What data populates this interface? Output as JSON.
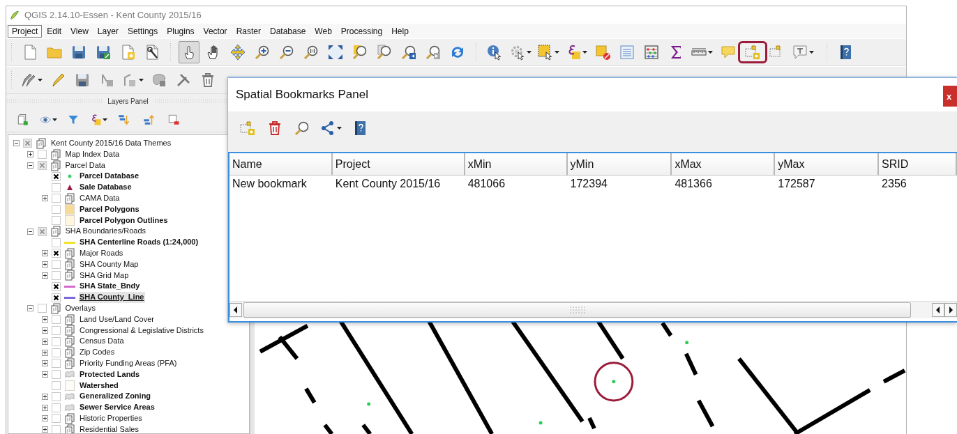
{
  "window": {
    "title": "QGIS 2.14.10-Essen - Kent County 2015/16"
  },
  "menu": [
    {
      "label": "Project",
      "selected": true
    },
    {
      "label": "Edit",
      "selected": false
    },
    {
      "label": "View",
      "selected": false
    },
    {
      "label": "Layer",
      "selected": false
    },
    {
      "label": "Settings",
      "selected": false
    },
    {
      "label": "Plugins",
      "selected": false
    },
    {
      "label": "Vector",
      "selected": false
    },
    {
      "label": "Raster",
      "selected": false
    },
    {
      "label": "Database",
      "selected": false
    },
    {
      "label": "Web",
      "selected": false
    },
    {
      "label": "Processing",
      "selected": false
    },
    {
      "label": "Help",
      "selected": false
    }
  ],
  "toolbars": [
    {
      "groups": [
        {
          "buttons": [
            {
              "kind": "page"
            },
            {
              "kind": "folder"
            },
            {
              "kind": "floppy"
            },
            {
              "kind": "floppy_edit"
            },
            {
              "kind": "page_star"
            },
            {
              "kind": "page_wrench"
            }
          ]
        },
        {
          "buttons": [
            {
              "kind": "touch",
              "selected": true
            },
            {
              "kind": "hand",
              "selected": false
            },
            {
              "kind": "arrows",
              "selected": false
            },
            {
              "kind": "zoom_in",
              "selected": false
            },
            {
              "kind": "zoom_out",
              "selected": false
            },
            {
              "kind": "zoom_native",
              "selected": false
            },
            {
              "kind": "extent",
              "selected": false
            },
            {
              "kind": "zoom_layer",
              "selected": false
            },
            {
              "kind": "zoom_sel",
              "selected": false
            },
            {
              "kind": "zoom_last",
              "selected": false
            },
            {
              "kind": "zoom_next",
              "selected": false
            },
            {
              "kind": "refresh",
              "selected": false
            }
          ]
        },
        {
          "buttons": [
            {
              "kind": "info"
            },
            {
              "kind": "gear",
              "menu": true
            },
            {
              "kind": "select",
              "menu": true
            },
            {
              "kind": "epsilon",
              "menu": true
            },
            {
              "kind": "deselect"
            },
            {
              "kind": "table"
            },
            {
              "kind": "abacus"
            },
            {
              "kind": "sigma"
            },
            {
              "kind": "ruler",
              "menu": true
            },
            {
              "kind": "balloon"
            },
            {
              "kind": "bookmark_new",
              "highlighted": true
            },
            {
              "kind": "bookmarks"
            },
            {
              "kind": "text_balloon",
              "menu": true
            }
          ]
        },
        {
          "buttons": [
            {
              "kind": "help"
            }
          ]
        }
      ]
    },
    {
      "groups": [
        {
          "buttons": [
            {
              "kind": "pencils_gray",
              "menu": true
            },
            {
              "kind": "pencil"
            },
            {
              "kind": "save_gray"
            },
            {
              "kind": "vertex"
            },
            {
              "kind": "node",
              "menu": true
            },
            {
              "kind": "blob"
            },
            {
              "kind": "pen_wrench"
            },
            {
              "kind": "trash_gray"
            }
          ]
        }
      ]
    }
  ],
  "layers_panel": {
    "title": "Layers Panel",
    "tools": [
      {
        "kind": "add_group"
      },
      {
        "kind": "eye",
        "menu": true
      },
      {
        "kind": "filter"
      },
      {
        "kind": "epsilon",
        "menu": true
      },
      {
        "kind": "expand_all"
      },
      {
        "kind": "collapse_all"
      },
      {
        "kind": "remove_layer"
      }
    ],
    "tree": [
      {
        "label": "Kent County 2015/16 Data Themes",
        "kind": "group",
        "checked": false,
        "partial": true,
        "expanded": true,
        "selected": false,
        "children": [
          {
            "label": "Map Index Data",
            "kind": "group",
            "checked": false,
            "partial": false,
            "expanded": false,
            "selected": false
          },
          {
            "label": "Parcel Data",
            "kind": "group",
            "checked": false,
            "partial": true,
            "expanded": true,
            "selected": false,
            "children": [
              {
                "label": "Parcel Database",
                "kind": "point",
                "color": "#3ccf6e",
                "checked": true,
                "partial": false,
                "selected": false
              },
              {
                "label": "Sale Database",
                "kind": "triangle",
                "color": "#a3174a",
                "checked": false,
                "partial": false,
                "selected": false
              },
              {
                "label": "CAMA Data",
                "kind": "group",
                "checked": false,
                "partial": false,
                "expanded": false,
                "selected": false
              },
              {
                "label": "Parcel Polygons",
                "kind": "polygon",
                "color": "#f6dc9a",
                "checked": false,
                "partial": false,
                "selected": false
              },
              {
                "label": "Parcel Polygon Outlines",
                "kind": "polygon",
                "color": "#fff6e0",
                "checked": false,
                "partial": false,
                "selected": false
              }
            ]
          },
          {
            "label": "SHA Boundaries/Roads",
            "kind": "group",
            "checked": false,
            "partial": true,
            "expanded": true,
            "selected": false,
            "children": [
              {
                "label": "SHA Centerline Roads (1:24,000)",
                "kind": "line",
                "color": "#f3e22a",
                "checked": false,
                "partial": false,
                "selected": false
              },
              {
                "label": "Major Roads",
                "kind": "group",
                "checked": true,
                "partial": false,
                "expanded": false,
                "selected": false
              },
              {
                "label": "SHA County Map",
                "kind": "group",
                "checked": false,
                "partial": false,
                "expanded": false,
                "selected": false
              },
              {
                "label": "SHA Grid Map",
                "kind": "group",
                "checked": false,
                "partial": false,
                "expanded": false,
                "selected": false
              },
              {
                "label": "SHA State_Bndy",
                "kind": "line",
                "color": "#d46ad0",
                "checked": true,
                "partial": false,
                "selected": false
              },
              {
                "label": "SHA County_Line",
                "kind": "line",
                "color": "#7a6ad8",
                "checked": true,
                "partial": false,
                "selected": true
              }
            ]
          },
          {
            "label": "Overlays",
            "kind": "group",
            "checked": false,
            "partial": false,
            "expanded": true,
            "selected": false,
            "children": [
              {
                "label": "Land Use/Land Cover",
                "kind": "group",
                "checked": false,
                "partial": false,
                "expanded": false,
                "selected": false
              },
              {
                "label": "Congressional & Legislative Districts",
                "kind": "group",
                "checked": false,
                "partial": false,
                "expanded": false,
                "selected": false
              },
              {
                "label": "Census Data",
                "kind": "group",
                "checked": false,
                "partial": false,
                "expanded": false,
                "selected": false
              },
              {
                "label": "Zip Codes",
                "kind": "group",
                "checked": false,
                "partial": false,
                "expanded": false,
                "selected": false
              },
              {
                "label": "Priority Funding Areas (PFA)",
                "kind": "group",
                "checked": false,
                "partial": false,
                "expanded": false,
                "selected": false
              },
              {
                "label": "Protected Lands",
                "kind": "categorized",
                "checked": false,
                "partial": false,
                "expanded": false,
                "selected": false
              },
              {
                "label": "Watershed",
                "kind": "polygon",
                "color": "#fcfcf8",
                "checked": false,
                "partial": false,
                "selected": false
              },
              {
                "label": "Generalized Zoning",
                "kind": "categorized",
                "checked": false,
                "partial": false,
                "expanded": false,
                "selected": false
              },
              {
                "label": "Sewer Service Areas",
                "kind": "categorized",
                "checked": false,
                "partial": false,
                "expanded": false,
                "selected": false
              },
              {
                "label": "Historic Properties",
                "kind": "group",
                "checked": false,
                "partial": false,
                "expanded": false,
                "selected": false
              },
              {
                "label": "Residential Sales",
                "kind": "group",
                "checked": false,
                "partial": false,
                "expanded": false,
                "selected": false
              }
            ]
          }
        ]
      }
    ]
  },
  "bookmarks": {
    "title": "Spatial Bookmarks Panel",
    "close": "x",
    "tools": [
      {
        "kind": "bookmark_new"
      },
      {
        "kind": "trash_red"
      },
      {
        "kind": "magnifier"
      },
      {
        "kind": "share",
        "menu": true
      },
      {
        "kind": "help"
      }
    ],
    "table": {
      "columns": [
        "Name",
        "Project",
        "xMin",
        "yMin",
        "xMax",
        "yMax",
        "SRID"
      ],
      "rows": [
        {
          "cells": [
            "New bookmark",
            "Kent County 2015/16",
            "481066",
            "172394",
            "481366",
            "172587",
            "2356"
          ],
          "selected": false
        }
      ]
    }
  }
}
